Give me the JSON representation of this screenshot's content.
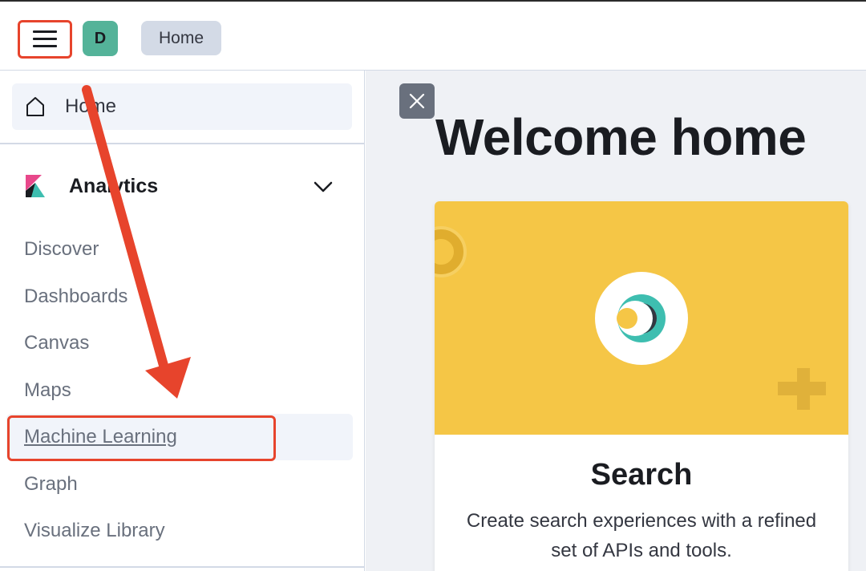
{
  "header": {
    "avatar_initial": "D",
    "breadcrumb": "Home"
  },
  "sidebar": {
    "home_label": "Home",
    "group": {
      "title": "Analytics",
      "items": [
        {
          "label": "Discover"
        },
        {
          "label": "Dashboards"
        },
        {
          "label": "Canvas"
        },
        {
          "label": "Maps"
        },
        {
          "label": "Machine Learning",
          "active": true
        },
        {
          "label": "Graph"
        },
        {
          "label": "Visualize Library"
        }
      ]
    }
  },
  "main": {
    "welcome": "Welcome home",
    "card": {
      "title": "Search",
      "description": "Create search experiences with a refined set of APIs and tools."
    }
  },
  "colors": {
    "accent_red": "#e7442c",
    "avatar_bg": "#54b399",
    "card_banner": "#f5c646"
  }
}
